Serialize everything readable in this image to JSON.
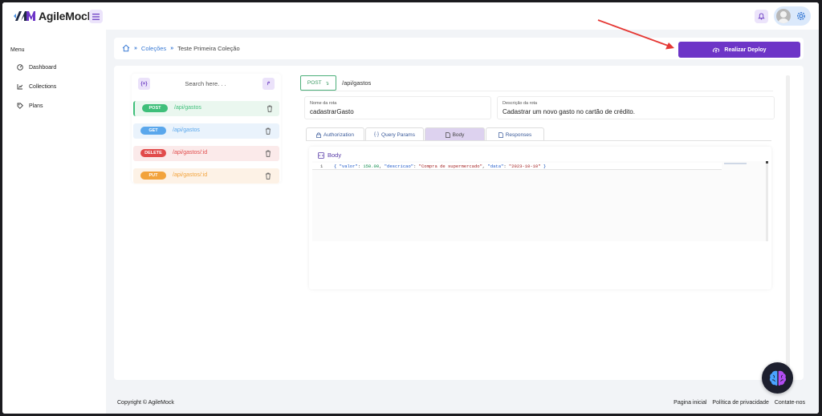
{
  "header": {
    "app_name": "AgileMock",
    "menu_toggle_icon": "hamburger-icon",
    "notification_icon": "bell-icon",
    "settings_icon": "gear-icon"
  },
  "sidebar": {
    "title": "Menu",
    "items": [
      {
        "label": "Dashboard",
        "icon": "dashboard-icon"
      },
      {
        "label": "Collections",
        "icon": "collections-icon"
      },
      {
        "label": "Plans",
        "icon": "tag-icon"
      }
    ]
  },
  "breadcrumb": {
    "collections": "Coleções",
    "current": "Teste Primeira Coleção"
  },
  "deploy": {
    "label": "Realizar Deploy"
  },
  "routes": {
    "search_placeholder": "Search here. . .",
    "items": [
      {
        "method": "POST",
        "path": "/api/gastos",
        "color": "#3fbf7a",
        "bg": "#eaf7ef"
      },
      {
        "method": "GET",
        "path": "/api/gastos",
        "color": "#5aa7ec",
        "bg": "#eaf3fc"
      },
      {
        "method": "DELETE",
        "path": "/api/gastos/:id",
        "color": "#e14b4b",
        "bg": "#fbeaea"
      },
      {
        "method": "PUT",
        "path": "/api/gastos/:id",
        "color": "#f2a33c",
        "bg": "#fdf2e6"
      }
    ]
  },
  "route_detail": {
    "method": "POST",
    "path": "/api/gastos",
    "name_label": "Nome da rota",
    "name_value": "cadastrarGasto",
    "desc_label": "Descrição da rota",
    "desc_value": "Cadastrar um novo gasto no cartão de crédito.",
    "tabs": [
      {
        "label": "Authorization",
        "icon": "lock-icon"
      },
      {
        "label": "Query Params",
        "icon": "braces-icon"
      },
      {
        "label": "Body",
        "icon": "file-icon",
        "active": true
      },
      {
        "label": "Responses",
        "icon": "file-icon"
      }
    ],
    "body_title": "Body",
    "code": {
      "line_number": "1",
      "open": "{ ",
      "k1": "\"valor\"",
      "v1": "150.00",
      "k2": "\"descricao\"",
      "v2": "\"Compra de supermercado\"",
      "k3": "\"data\"",
      "v3": "\"2023-10-10\"",
      "close": " }"
    }
  },
  "footer": {
    "copyright": "Copyright © AgileMock",
    "links": [
      "Pagina inicial",
      "Política de privacidade",
      "Contate-nos"
    ]
  },
  "colors": {
    "accent": "#6d35c7",
    "link": "#3a7bd5",
    "annotation_arrow": "#e53935"
  }
}
